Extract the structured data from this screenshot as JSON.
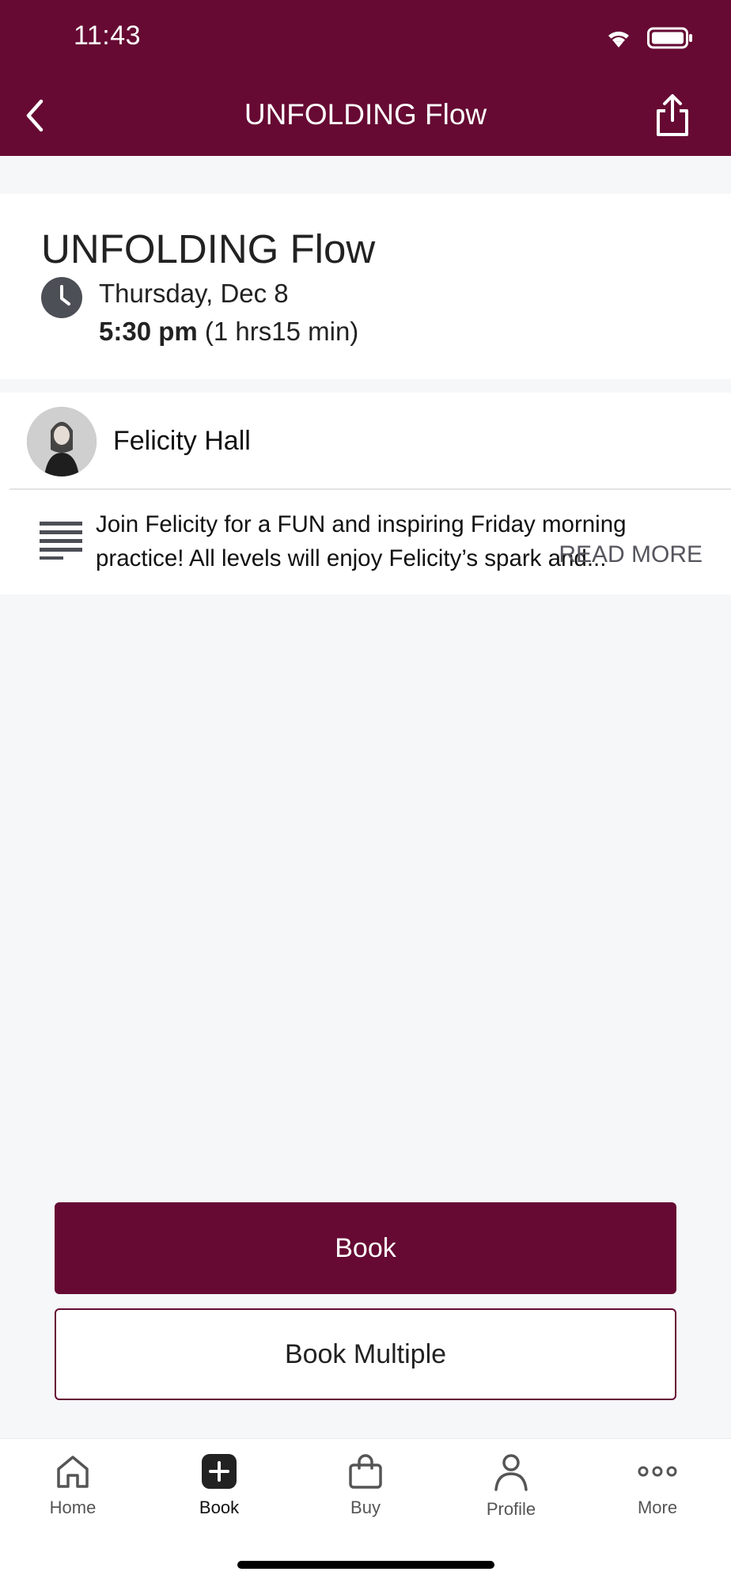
{
  "status_bar": {
    "time": "11:43"
  },
  "nav": {
    "title": "UNFOLDING Flow"
  },
  "class_info": {
    "title": "UNFOLDING Flow",
    "date": "Thursday, Dec 8",
    "time": "5:30 pm",
    "duration": "(1 hrs15 min)"
  },
  "instructor": {
    "name": "Felicity Hall"
  },
  "description": {
    "text": "Join Felicity for a FUN and inspiring Friday morning practice! All levels will enjoy Felicity’s spark and...",
    "read_more": "READ MORE"
  },
  "actions": {
    "book_label": "Book",
    "book_multiple_label": "Book Multiple"
  },
  "tabs": [
    {
      "label": "Home",
      "icon": "home-icon"
    },
    {
      "label": "Book",
      "icon": "plus-square-icon",
      "active": true
    },
    {
      "label": "Buy",
      "icon": "bag-icon"
    },
    {
      "label": "Profile",
      "icon": "person-icon"
    },
    {
      "label": "More",
      "icon": "more-dots-icon"
    }
  ],
  "colors": {
    "brand": "#660a33",
    "background": "#f6f7f9"
  }
}
